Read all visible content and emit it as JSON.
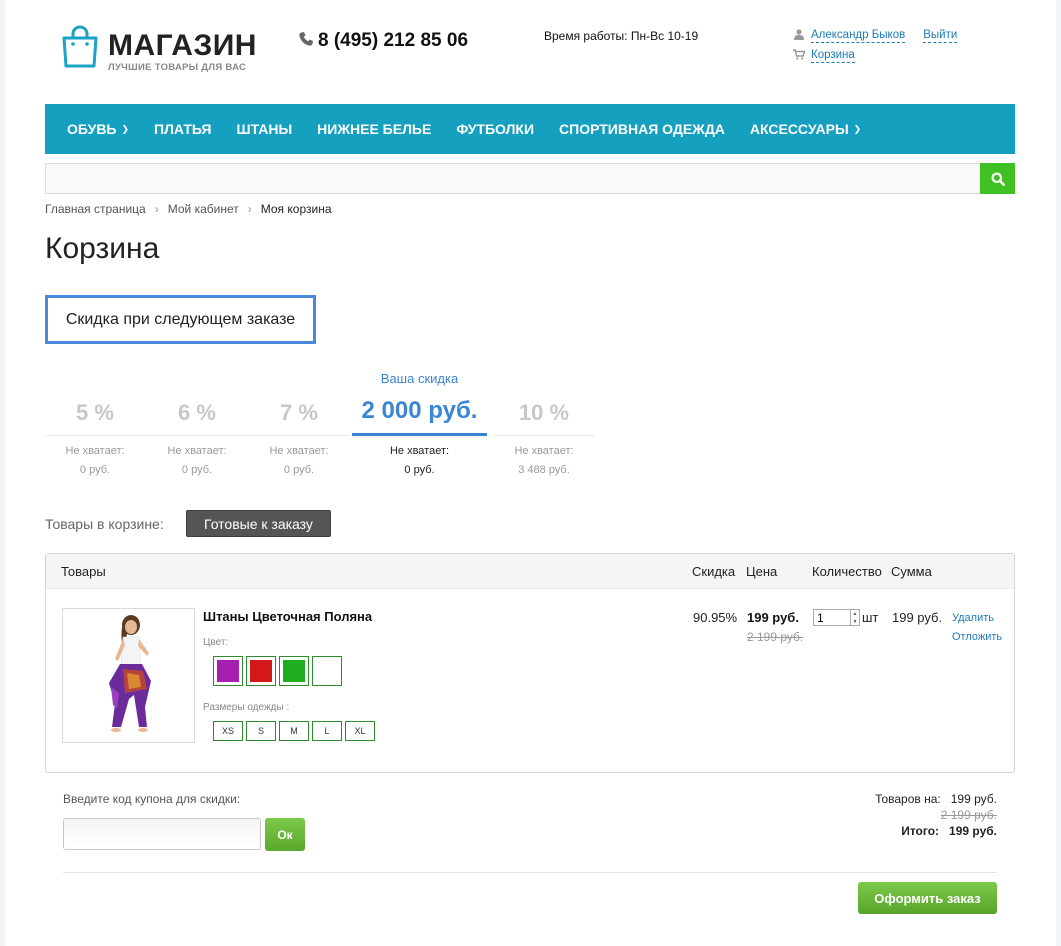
{
  "header": {
    "logo_main": "МАГАЗИН",
    "logo_sub": "ЛУЧШИЕ ТОВАРЫ ДЛЯ ВАС",
    "phone": "8 (495) 212 85 06",
    "hours": "Время работы: Пн-Вс 10-19",
    "user_name": "Александр Быков",
    "logout": "Выйти",
    "cart_link": "Корзина"
  },
  "nav": {
    "items": [
      {
        "label": "ОБУВЬ",
        "has_dropdown": true
      },
      {
        "label": "ПЛАТЬЯ",
        "has_dropdown": false
      },
      {
        "label": "ШТАНЫ",
        "has_dropdown": false
      },
      {
        "label": "НИЖНЕЕ БЕЛЬЕ",
        "has_dropdown": false
      },
      {
        "label": "ФУТБОЛКИ",
        "has_dropdown": false
      },
      {
        "label": "СПОРТИВНАЯ ОДЕЖДА",
        "has_dropdown": false
      },
      {
        "label": "АКСЕССУАРЫ",
        "has_dropdown": true
      }
    ]
  },
  "search": {
    "placeholder": "",
    "value": ""
  },
  "breadcrumb": [
    "Главная страница",
    "Мой кабинет",
    "Моя корзина"
  ],
  "page_title": "Корзина",
  "discount_box_label": "Скидка при следующем заказе",
  "discount_steps": [
    {
      "value": "5 %",
      "need": "Не хватает:",
      "amount": "0 руб.",
      "active": false
    },
    {
      "value": "6 %",
      "need": "Не хватает:",
      "amount": "0 руб.",
      "active": false
    },
    {
      "value": "7 %",
      "need": "Не хватает:",
      "amount": "0 руб.",
      "active": false
    },
    {
      "label": "Ваша скидка",
      "value": "2 000 руб.",
      "need": "Не хватает:",
      "amount": "0 руб.",
      "active": true
    },
    {
      "value": "10 %",
      "need": "Не хватает:",
      "amount": "3 488 руб.",
      "active": false
    }
  ],
  "cart_section": {
    "items_label": "Товары в корзине:",
    "ready_button": "Готовые к заказу"
  },
  "cart_table": {
    "headers": {
      "product": "Товары",
      "discount": "Скидка",
      "price": "Цена",
      "quantity": "Количество",
      "sum": "Сумма"
    },
    "item": {
      "name": "Штаны Цветочная Поляна",
      "color_label": "Цвет:",
      "colors": [
        "#a61fb0",
        "#d41717",
        "#1fae1f",
        "#ffffff"
      ],
      "size_label": "Размеры одежды :",
      "sizes": [
        "XS",
        "S",
        "M",
        "L",
        "XL"
      ],
      "discount": "90.95%",
      "price": "199 руб.",
      "old_price": "2 199 руб.",
      "quantity": "1",
      "unit": "шт",
      "sum": "199 руб.",
      "delete": "Удалить",
      "postpone": "Отложить"
    }
  },
  "coupon": {
    "label": "Введите код купона для скидки:",
    "value": "",
    "button": "Ок"
  },
  "totals": {
    "goods_label": "Товаров на:",
    "goods_value": "199 руб.",
    "old_value": "2 199 руб.",
    "total_label": "Итого:",
    "total_value": "199 руб."
  },
  "order_button": "Оформить заказ",
  "colors": {
    "nav": "#15a0c0",
    "accent_blue": "#3b86d4",
    "green": "#3fc123"
  }
}
